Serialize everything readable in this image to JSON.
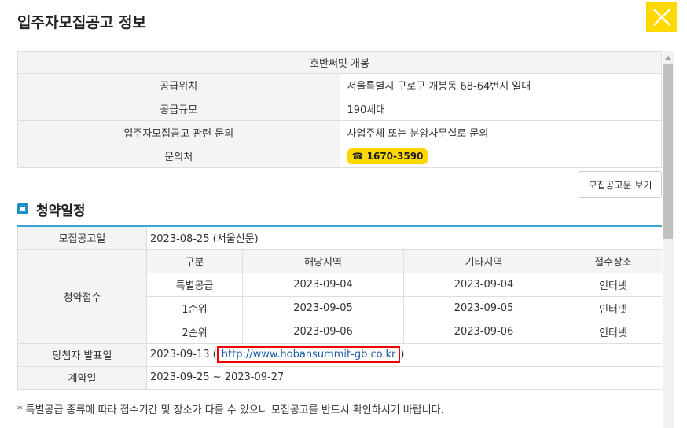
{
  "dialog": {
    "title": "입주자모집공고 정보"
  },
  "info": {
    "complex_name": "호반써밋 개봉",
    "rows": [
      {
        "label": "공급위치",
        "value": "서울특별시 구로구 개봉동 68-64번지 일대"
      },
      {
        "label": "공급규모",
        "value": "190세대"
      },
      {
        "label": "입주자모집공고 관련 문의",
        "value": "사업주체 또는 분양사무실로 문의"
      }
    ],
    "contact_label": "문의처",
    "contact_phone": "☎ 1670-3590"
  },
  "notice_button": "모집공고문 보기",
  "schedule": {
    "title": "청약일정",
    "announcement_label": "모집공고일",
    "announcement_value": "2023-08-25 (서울신문)",
    "application_label": "청약접수",
    "columns": [
      "구분",
      "해당지역",
      "기타지역",
      "접수장소"
    ],
    "rows": [
      [
        "특별공급",
        "2023-09-04",
        "2023-09-04",
        "인터넷"
      ],
      [
        "1순위",
        "2023-09-05",
        "2023-09-05",
        "인터넷"
      ],
      [
        "2순위",
        "2023-09-06",
        "2023-09-06",
        "인터넷"
      ]
    ],
    "winner_label": "당첨자 발표일",
    "winner_date": "2023-09-13 (",
    "winner_link": "http://www.hobansummit-gb.co.kr",
    "winner_close": ")",
    "contract_label": "계약일",
    "contract_value": "2023-09-25 ~ 2023-09-27"
  },
  "footnote": "* 특별공급 종류에 따라 접수기간 및 장소가 다를 수 있으니 모집공고를 반드시 확인하시기 바랍니다.",
  "colors": {
    "accent_yellow": "#ffd900",
    "section_blue": "#1e90c8",
    "table_top_border": "#3aa5d6",
    "link_box": "#ee0000"
  }
}
